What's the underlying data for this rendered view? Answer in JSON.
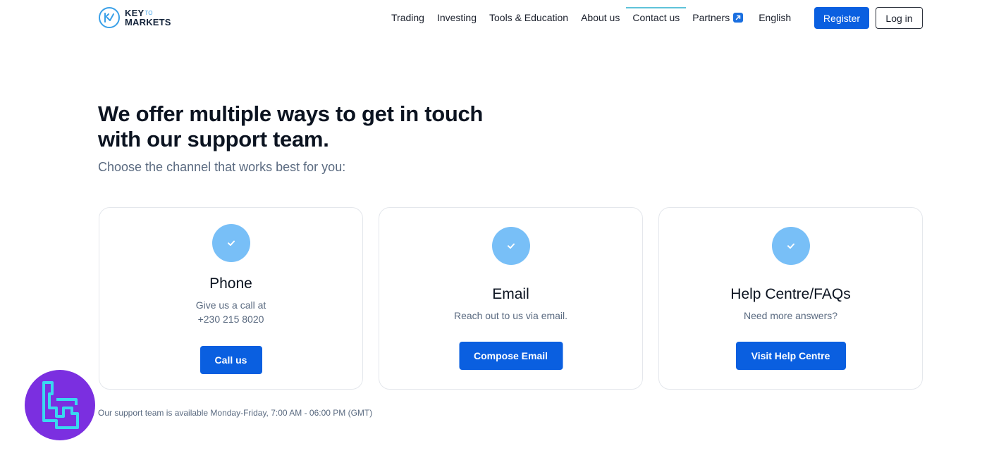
{
  "header": {
    "logo": {
      "line1": "KEY",
      "line1_small": "TO",
      "line2": "MARKETS"
    },
    "nav": [
      {
        "label": "Trading"
      },
      {
        "label": "Investing"
      },
      {
        "label": "Tools & Education"
      },
      {
        "label": "About us",
        "active": false
      },
      {
        "label": "Contact us",
        "active": true
      },
      {
        "label": "Partners",
        "icon": "external-link-icon"
      }
    ],
    "language": "English",
    "register_label": "Register",
    "login_label": "Log in"
  },
  "hero": {
    "title_line1": "We offer multiple ways to get in touch",
    "title_line2": "with our support team.",
    "subtitle": "Choose the channel that works best for you:"
  },
  "cards": [
    {
      "icon": "check-icon",
      "title": "Phone",
      "text_line1": "Give us a call at",
      "text_line2": "+230 215 8020",
      "button": "Call us"
    },
    {
      "icon": "check-icon",
      "title": "Email",
      "text_line1": "Reach out to us via email.",
      "button": "Compose Email"
    },
    {
      "icon": "check-icon",
      "title": "Help Centre/FAQs",
      "text_line1": "Need more answers?",
      "button": "Visit Help Centre"
    }
  ],
  "footnote": "Our support team is available Monday-Friday, 7:00 AM - 06:00 PM (GMT)",
  "colors": {
    "primary": "#0a5fe0",
    "check_circle": "#78bff7",
    "active_underline": "#5fc3d9",
    "badge": "#7b2fe0",
    "badge_mark": "#39d8f0"
  }
}
